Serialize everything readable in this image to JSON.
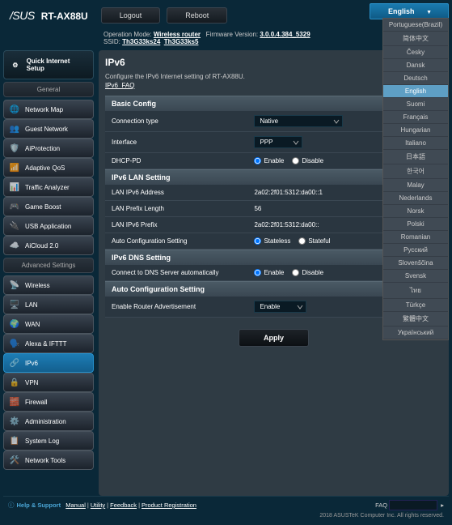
{
  "brand": "/SUS",
  "model": "RT-AX88U",
  "logout": "Logout",
  "reboot": "Reboot",
  "lang_current": "English",
  "languages": [
    "Portuguese(Brazil)",
    "简体中文",
    "Česky",
    "Dansk",
    "Deutsch",
    "English",
    "Suomi",
    "Français",
    "Hungarian",
    "Italiano",
    "日本語",
    "한국어",
    "Malay",
    "Nederlands",
    "Norsk",
    "Polski",
    "Romanian",
    "Русский",
    "Slovenščina",
    "Svensk",
    "ไทย",
    "Türkçe",
    "繁體中文",
    "Український"
  ],
  "lang_active_index": 5,
  "info": {
    "op_mode_label": "Operation Mode:",
    "op_mode": "Wireless router",
    "fw_label": "Firmware Version:",
    "fw": "3.0.0.4.384_5329",
    "ssid_label": "SSID:",
    "ssid1": "Th3G33ks24",
    "ssid2": "Th3G33ks5"
  },
  "quick_setup": "Quick Internet Setup",
  "general_label": "General",
  "general": [
    {
      "icon": "🌐",
      "label": "Network Map"
    },
    {
      "icon": "👥",
      "label": "Guest Network"
    },
    {
      "icon": "🛡️",
      "label": "AiProtection"
    },
    {
      "icon": "📶",
      "label": "Adaptive QoS"
    },
    {
      "icon": "📊",
      "label": "Traffic Analyzer"
    },
    {
      "icon": "🎮",
      "label": "Game Boost"
    },
    {
      "icon": "🔌",
      "label": "USB Application"
    },
    {
      "icon": "☁️",
      "label": "AiCloud 2.0"
    }
  ],
  "advanced_label": "Advanced Settings",
  "advanced": [
    {
      "icon": "📡",
      "label": "Wireless"
    },
    {
      "icon": "🖥️",
      "label": "LAN"
    },
    {
      "icon": "🌍",
      "label": "WAN"
    },
    {
      "icon": "🗣️",
      "label": "Alexa & IFTTT"
    },
    {
      "icon": "🔗",
      "label": "IPv6"
    },
    {
      "icon": "🔒",
      "label": "VPN"
    },
    {
      "icon": "🧱",
      "label": "Firewall"
    },
    {
      "icon": "⚙️",
      "label": "Administration"
    },
    {
      "icon": "📋",
      "label": "System Log"
    },
    {
      "icon": "🛠️",
      "label": "Network Tools"
    }
  ],
  "advanced_active_index": 4,
  "page": {
    "title": "IPv6",
    "desc": "Configure the IPv6 Internet setting of RT-AX88U.",
    "faq": "IPv6_FAQ",
    "sections": {
      "basic": "Basic Config",
      "lan": "IPv6 LAN Setting",
      "dns": "IPv6 DNS Setting",
      "auto": "Auto Configuration Setting"
    },
    "fields": {
      "conn_type_label": "Connection type",
      "conn_type_value": "Native",
      "interface_label": "Interface",
      "interface_value": "PPP",
      "dhcp_pd_label": "DHCP-PD",
      "lan_addr_label": "LAN IPv6 Address",
      "lan_addr_value": "2a02:2f01:5312:da00::1",
      "lan_prefix_len_label": "LAN Prefix Length",
      "lan_prefix_len_value": "56",
      "lan_prefix_label": "LAN IPv6 Prefix",
      "lan_prefix_value": "2a02:2f01:5312:da00::",
      "auto_cfg_label": "Auto Configuration Setting",
      "dns_auto_label": "Connect to DNS Server automatically",
      "router_adv_label": "Enable Router Advertisement",
      "router_adv_value": "Enable"
    },
    "radio": {
      "enable": "Enable",
      "disable": "Disable",
      "stateless": "Stateless",
      "stateful": "Stateful"
    },
    "apply": "Apply"
  },
  "footer": {
    "help": "Help & Support",
    "manual": "Manual",
    "utility": "Utility",
    "feedback": "Feedback",
    "prodreg": "Product Registration",
    "faq_label": "FAQ",
    "copyright": "2018 ASUSTeK Computer Inc. All rights reserved."
  }
}
